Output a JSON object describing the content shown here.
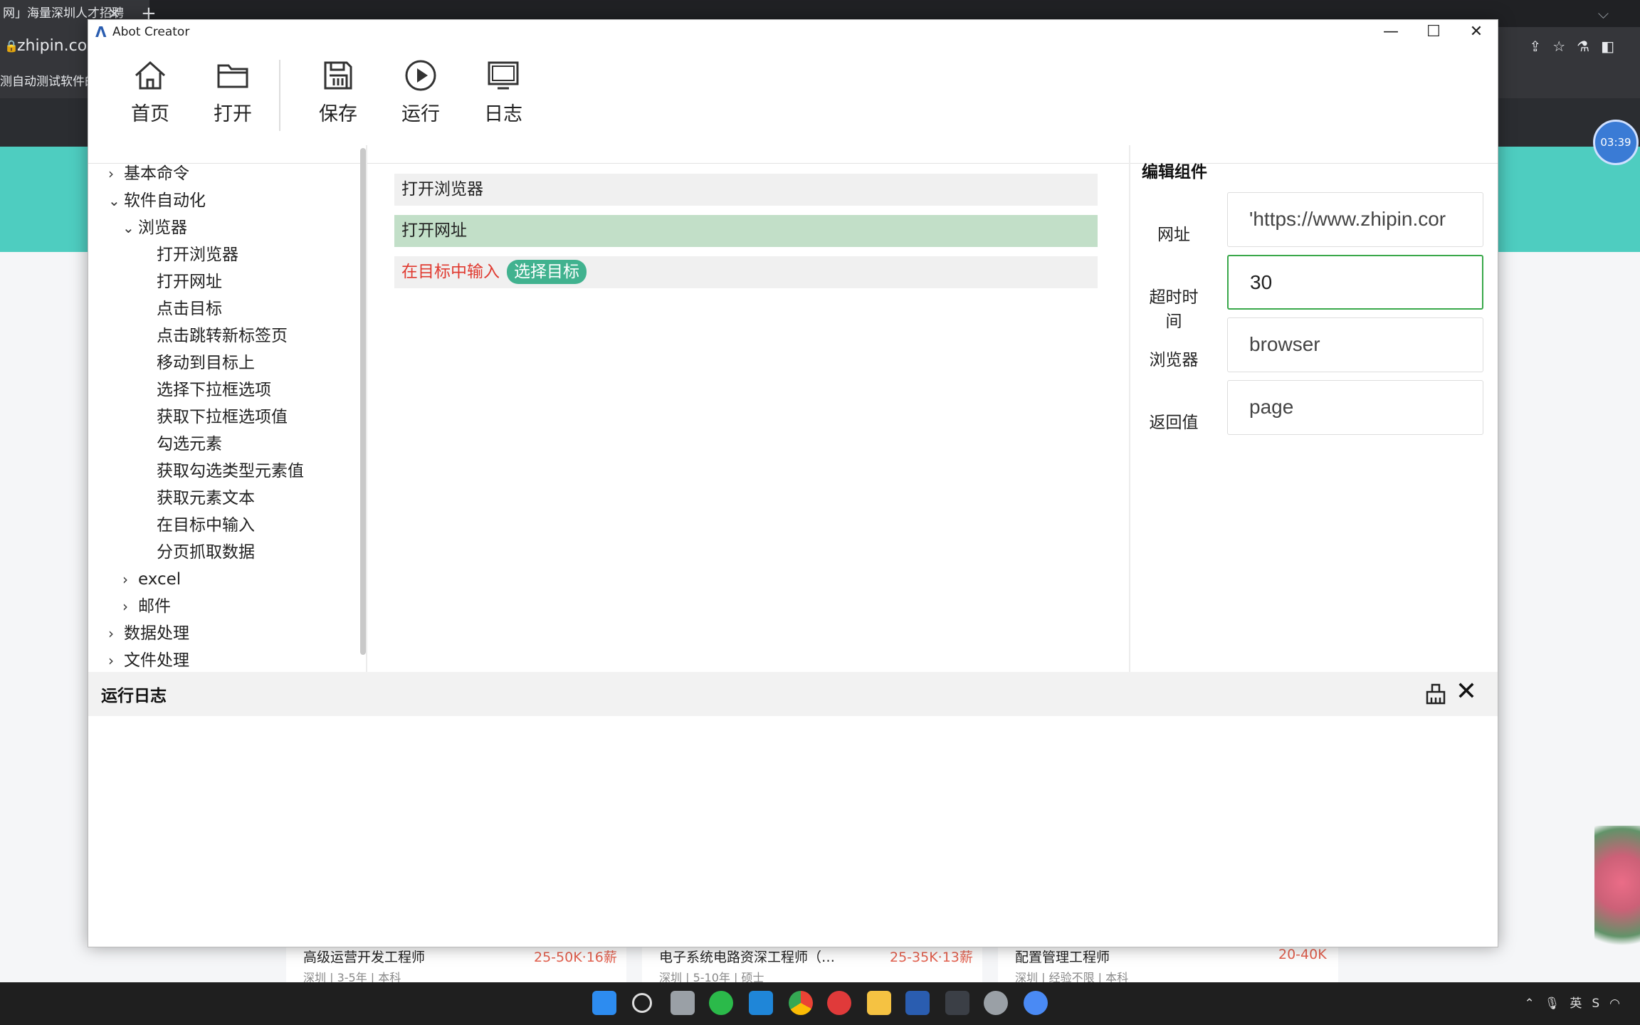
{
  "browser": {
    "tab_title": "网」海量深圳人才招聘",
    "tab_close": "✕",
    "new_tab": "+",
    "url": "zhipin.co",
    "bookmark": "测自动测试软件的",
    "timer": "03:39"
  },
  "jobs": [
    {
      "title": "高级运营开发工程师",
      "salary": "25-50K·16薪",
      "meta": "深圳 | 3-5年 | 本科"
    },
    {
      "title": "电子系统电路资深工程师（…",
      "salary": "25-35K·13薪",
      "meta": "深圳 | 5-10年 | 硕士"
    },
    {
      "title": "配置管理工程师",
      "salary": "20-40K",
      "meta": "深圳 | 经验不限 | 本科"
    }
  ],
  "taskbar": {
    "tray_ime": "英"
  },
  "app": {
    "title": "Abot Creator",
    "window_controls": {
      "minimize": "—",
      "maximize": "☐",
      "close": "✕"
    },
    "toolbar": {
      "home": "首页",
      "open": "打开",
      "save": "保存",
      "run": "运行",
      "log": "日志"
    },
    "tree": {
      "basic": "基本命令",
      "automation": "软件自动化",
      "browser": "浏览器",
      "browser_items": [
        "打开浏览器",
        "打开网址",
        "点击目标",
        "点击跳转新标签页",
        "移动到目标上",
        "选择下拉框选项",
        "获取下拉框选项值",
        "勾选元素",
        "获取勾选类型元素值",
        "获取元素文本",
        "在目标中输入",
        "分页抓取数据"
      ],
      "excel": "excel",
      "mail": "邮件",
      "data": "数据处理",
      "file": "文件处理"
    },
    "commands": {
      "open_browser": "打开浏览器",
      "open_url": "打开网址",
      "input_target": "在目标中输入",
      "select_target": "选择目标"
    },
    "edit": {
      "title": "编辑组件",
      "url_label": "网址",
      "url_value": "'https://www.zhipin.cor",
      "timeout_label": "超时时间",
      "timeout_value": "30",
      "browser_label": "浏览器",
      "browser_value": "browser",
      "return_label": "返回值",
      "return_value": "page"
    },
    "log": {
      "title": "运行日志",
      "close": "✕"
    }
  }
}
